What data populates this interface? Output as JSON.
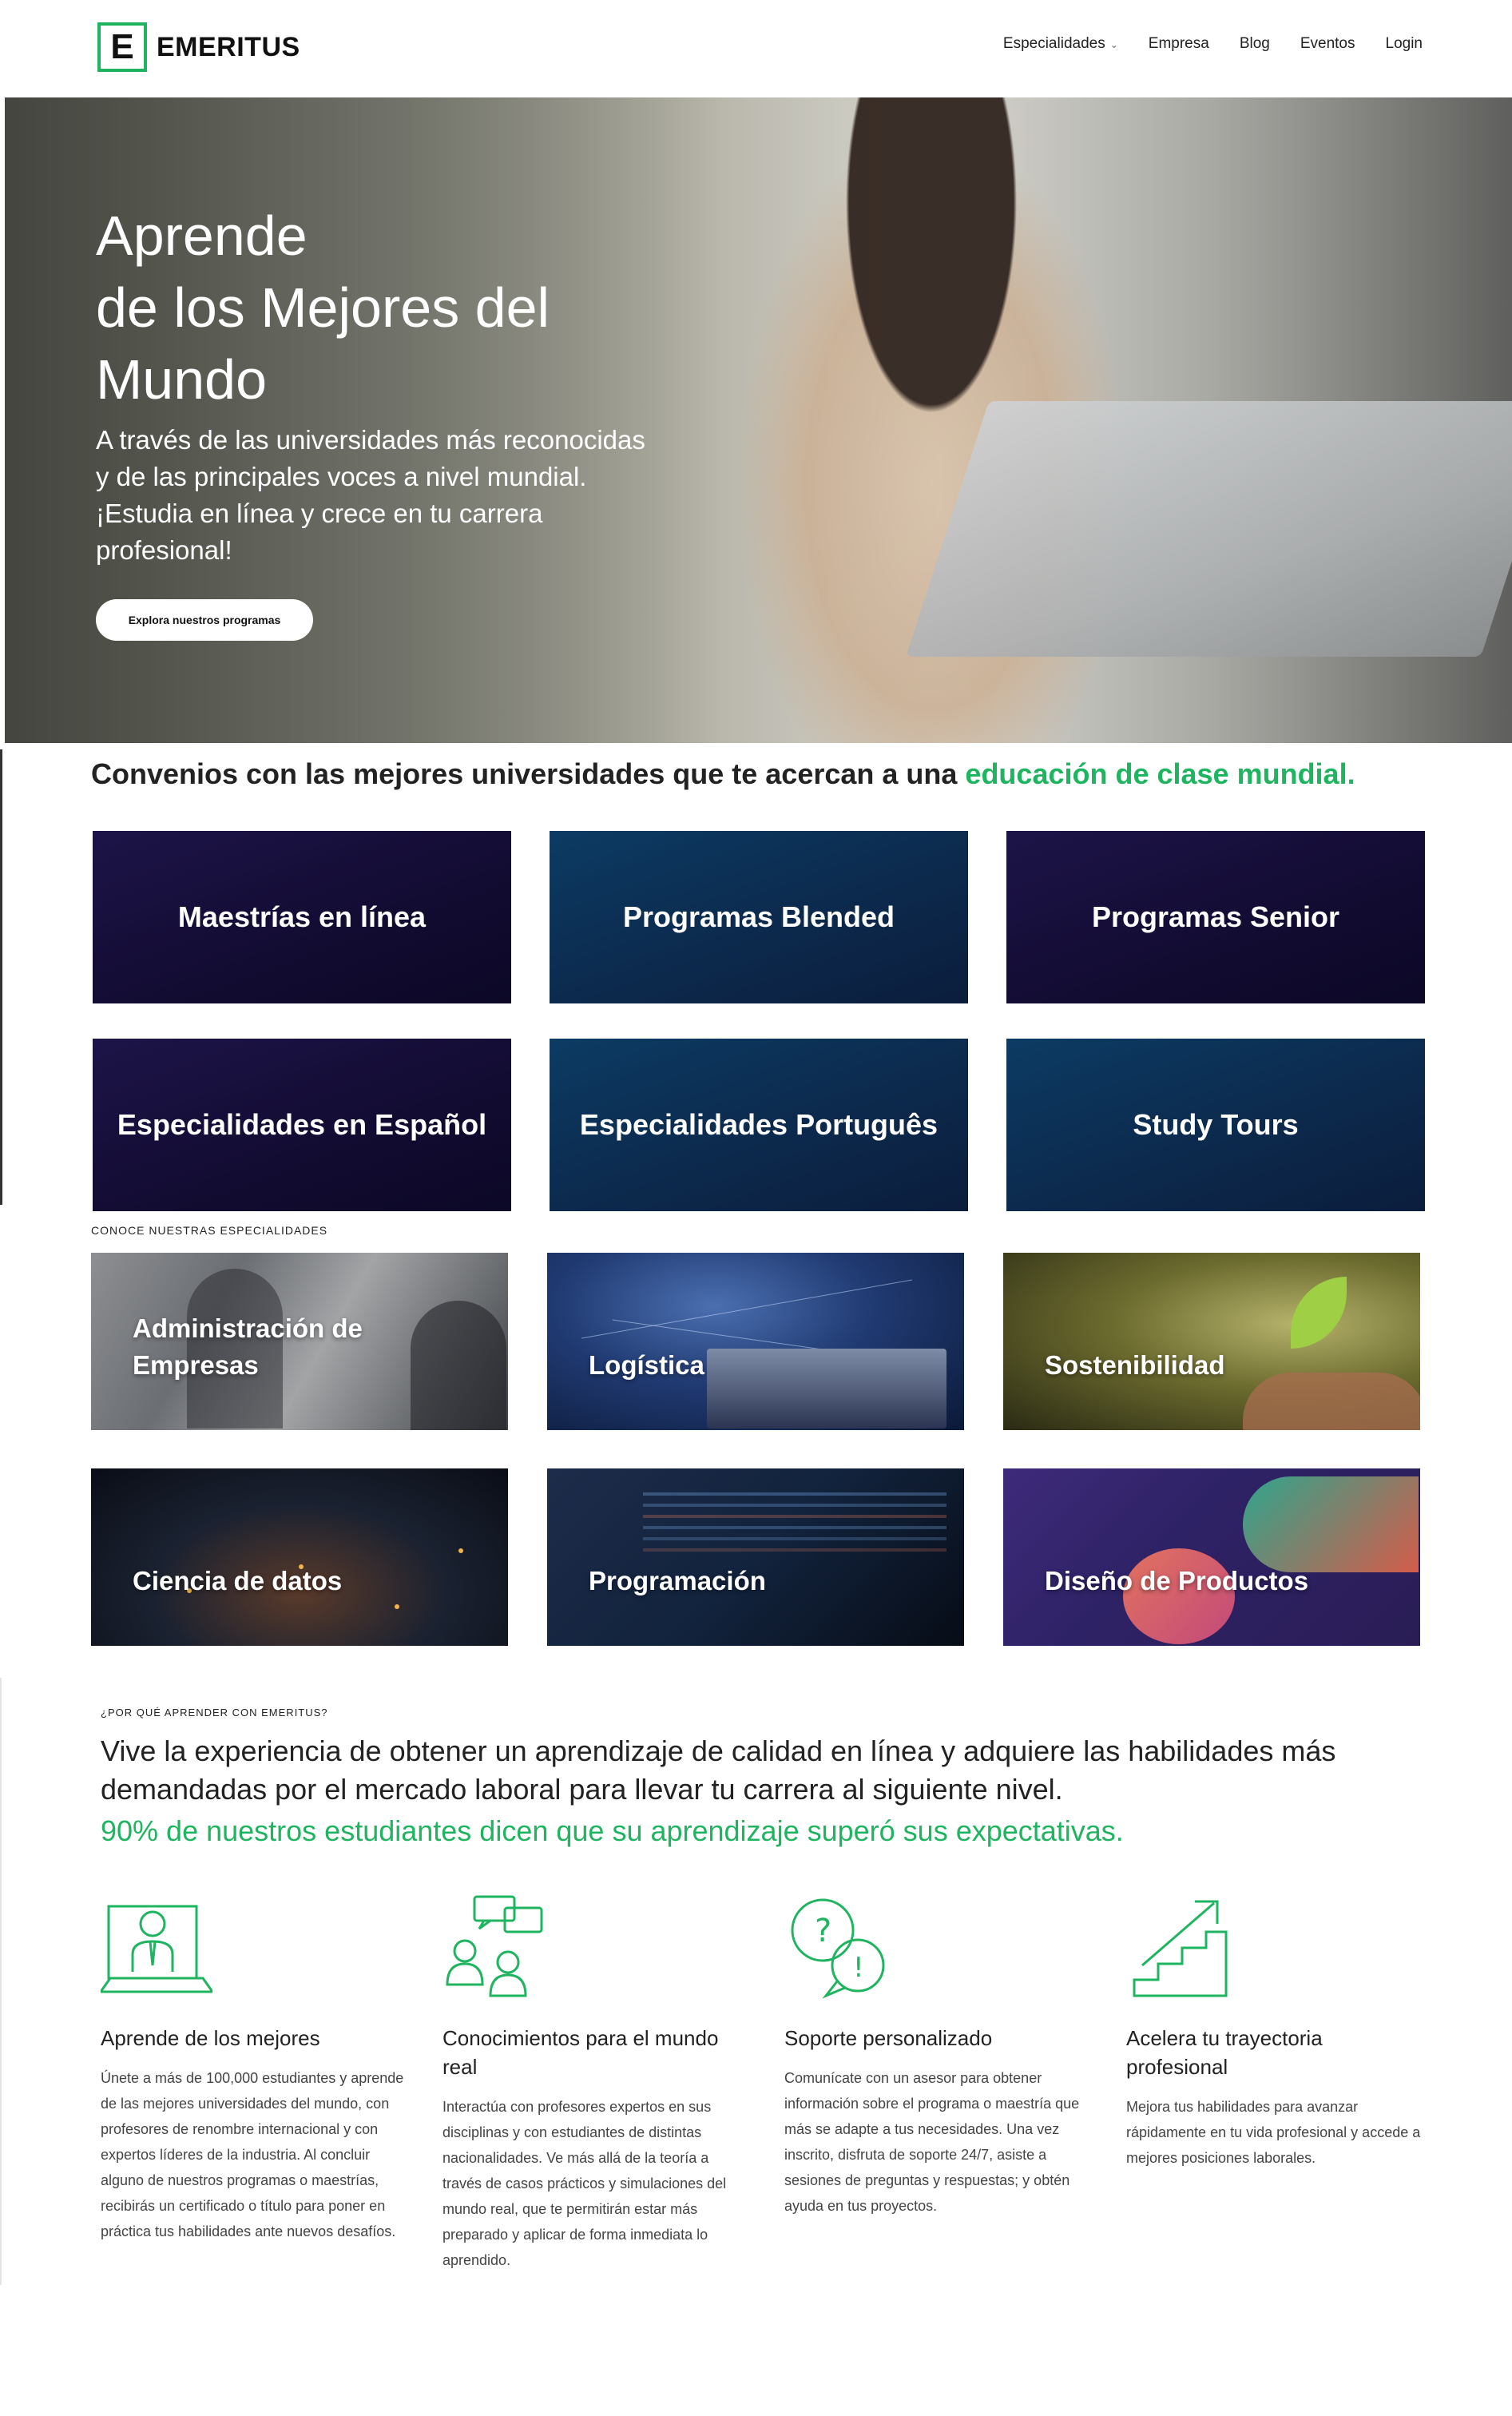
{
  "header": {
    "logo_letter": "E",
    "logo_text": "EMERITUS",
    "nav": [
      {
        "label": "Especialidades"
      },
      {
        "label": "Empresa"
      },
      {
        "label": "Blog"
      },
      {
        "label": "Eventos"
      },
      {
        "label": "Login"
      }
    ]
  },
  "hero": {
    "title_lines": [
      "Aprende",
      "de los Mejores del",
      "Mundo"
    ],
    "subtitle": "A través de las universidades más reconocidas y de las principales voces a nivel mundial. ¡Estudia en línea y crece en tu carrera profesional!",
    "cta": "Explora nuestros programas"
  },
  "convenios": {
    "text": "Convenios con las mejores universidades que te acercan a una ",
    "accent": "educación de clase mundial."
  },
  "programs": [
    {
      "label": "Maestrías en línea"
    },
    {
      "label": "Programas Blended"
    },
    {
      "label": "Programas Senior"
    },
    {
      "label": "Especialidades en Español"
    },
    {
      "label": "Especialidades Português"
    },
    {
      "label": "Study Tours"
    }
  ],
  "specialties": {
    "section_label": "CONOCE NUESTRAS ESPECIALIDADES",
    "items": [
      {
        "label": "Administración de Empresas"
      },
      {
        "label": "Logística"
      },
      {
        "label": "Sostenibilidad"
      },
      {
        "label": "Ciencia de datos"
      },
      {
        "label": "Programación"
      },
      {
        "label": "Diseño de Productos"
      }
    ]
  },
  "why": {
    "label": "¿POR QUÉ APRENDER CON EMERITUS?",
    "text": "Vive la experiencia de obtener un aprendizaje de calidad en línea y adquiere las habilidades más demandadas por el mercado laboral para llevar tu carrera al siguiente nivel.",
    "accent": "90% de nuestros estudiantes dicen que su aprendizaje superó sus expectativas.",
    "features": [
      {
        "icon": "teacher-screen-icon",
        "title": "Aprende de los mejores",
        "body": "Únete a más de 100,000 estudiantes y aprende de las mejores universidades del mundo, con profesores de renombre internacional y con expertos líderes de la industria. Al concluir alguno de nuestros programas o maestrías, recibirás un certificado o título para poner en práctica tus habilidades ante nuevos desafíos."
      },
      {
        "icon": "people-chat-icon",
        "title": "Conocimientos para el mundo real",
        "body": "Interactúa con profesores expertos en sus disciplinas y con estudiantes de distintas nacionalidades. Ve más allá de la teoría a través de casos prácticos y simulaciones del mundo real, que te permitirán estar más preparado y aplicar de forma inmediata lo aprendido."
      },
      {
        "icon": "question-bubbles-icon",
        "title": "Soporte personalizado",
        "body": "Comunícate con un asesor para obtener información sobre el programa o maestría que más se adapte a tus necesidades. Una vez inscrito, disfruta de soporte 24/7, asiste a sesiones de preguntas y respuestas; y obtén ayuda en tus proyectos."
      },
      {
        "icon": "stairs-arrow-icon",
        "title": "Acelera tu trayectoria profesional",
        "body": "Mejora tus habilidades para avanzar rápidamente en tu vida profesional y accede a mejores posiciones laborales."
      }
    ]
  },
  "colors": {
    "accent": "#1fb45f",
    "tile_dark": "#130c33",
    "tile_blue": "#0c2b4f"
  }
}
